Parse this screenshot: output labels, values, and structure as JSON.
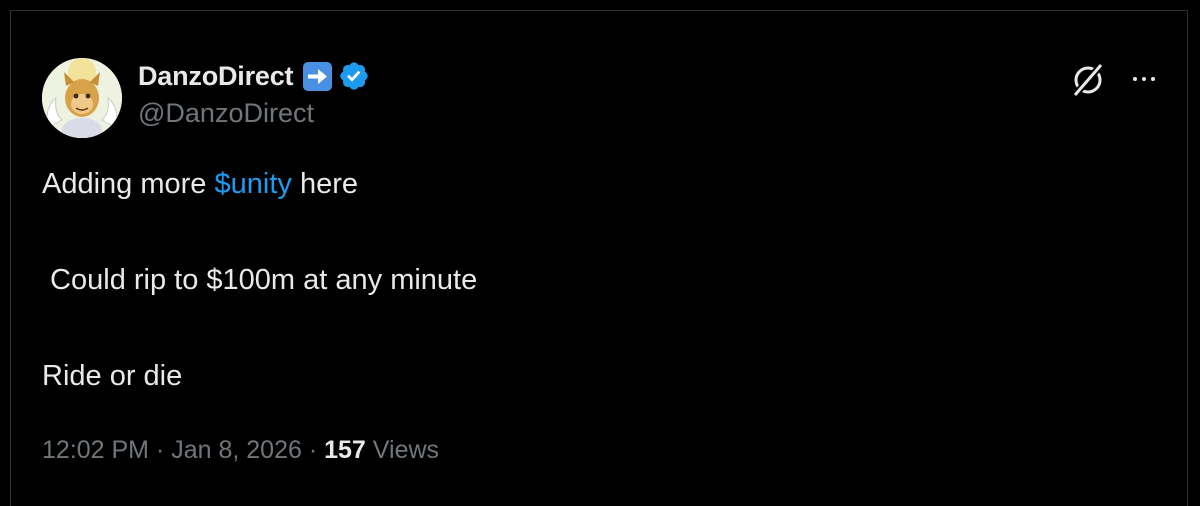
{
  "author": {
    "display_name": "DanzoDirect",
    "handle": "@DanzoDirect",
    "emoji": "right-arrow-emoji",
    "verified_badge": "verified-badge-icon",
    "verified_color": "#1d9bf0"
  },
  "header_actions": {
    "grok_icon": "grok-icon",
    "more_icon": "more-options-icon"
  },
  "body": {
    "line1_prefix": "Adding more ",
    "line1_cashtag": "$unity",
    "line1_suffix": " here",
    "line2": " Could rip to $100m at any minute",
    "line3": "Ride or die"
  },
  "meta": {
    "time": "12:02 PM",
    "separator": " · ",
    "date": "Jan 8, 2026",
    "views_count": "157",
    "views_label": " Views"
  },
  "colors": {
    "background": "#000000",
    "text_primary": "#e7e9ea",
    "text_secondary": "#71767b",
    "link": "#1d9bf0",
    "border": "#2f3336"
  }
}
